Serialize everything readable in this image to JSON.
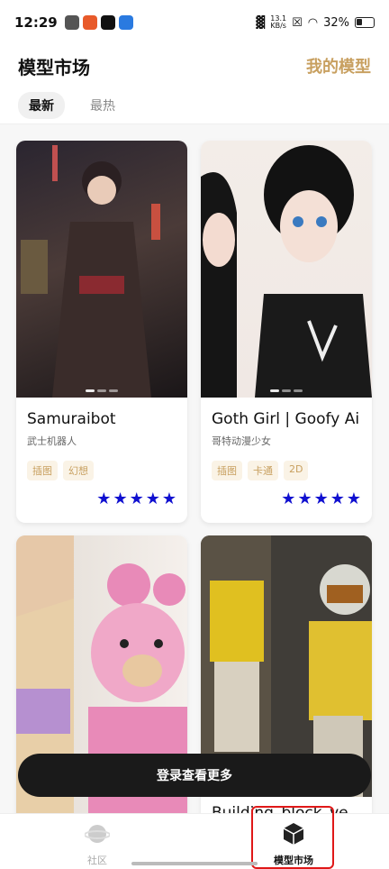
{
  "status_bar": {
    "time": "12:29",
    "net_speed_value": "13.1",
    "net_speed_unit": "KB/s",
    "battery": "32%"
  },
  "header": {
    "title": "模型市场",
    "my_models": "我的模型"
  },
  "tabs": [
    {
      "label": "最新",
      "active": true
    },
    {
      "label": "最热",
      "active": false
    }
  ],
  "cards": [
    {
      "name": "Samuraibot",
      "subtitle": "武士机器人",
      "tags": [
        "插图",
        "幻想"
      ],
      "rating": 5
    },
    {
      "name": "Goth Girl | Goofy Ai",
      "subtitle": "哥特动漫少女",
      "tags": [
        "插图",
        "卡通",
        "2D"
      ],
      "rating": 5
    },
    {
      "name": "",
      "subtitle": "",
      "tags": [],
      "rating": 0
    },
    {
      "name": "Building_block_ve",
      "subtitle": "",
      "tags": [],
      "rating": 0
    }
  ],
  "login_button": "登录查看更多",
  "bottom_nav": {
    "community": "社区",
    "market": "模型市场"
  },
  "colors": {
    "accent": "#c8a060",
    "star": "#1010d0",
    "highlight": "#e01818"
  }
}
